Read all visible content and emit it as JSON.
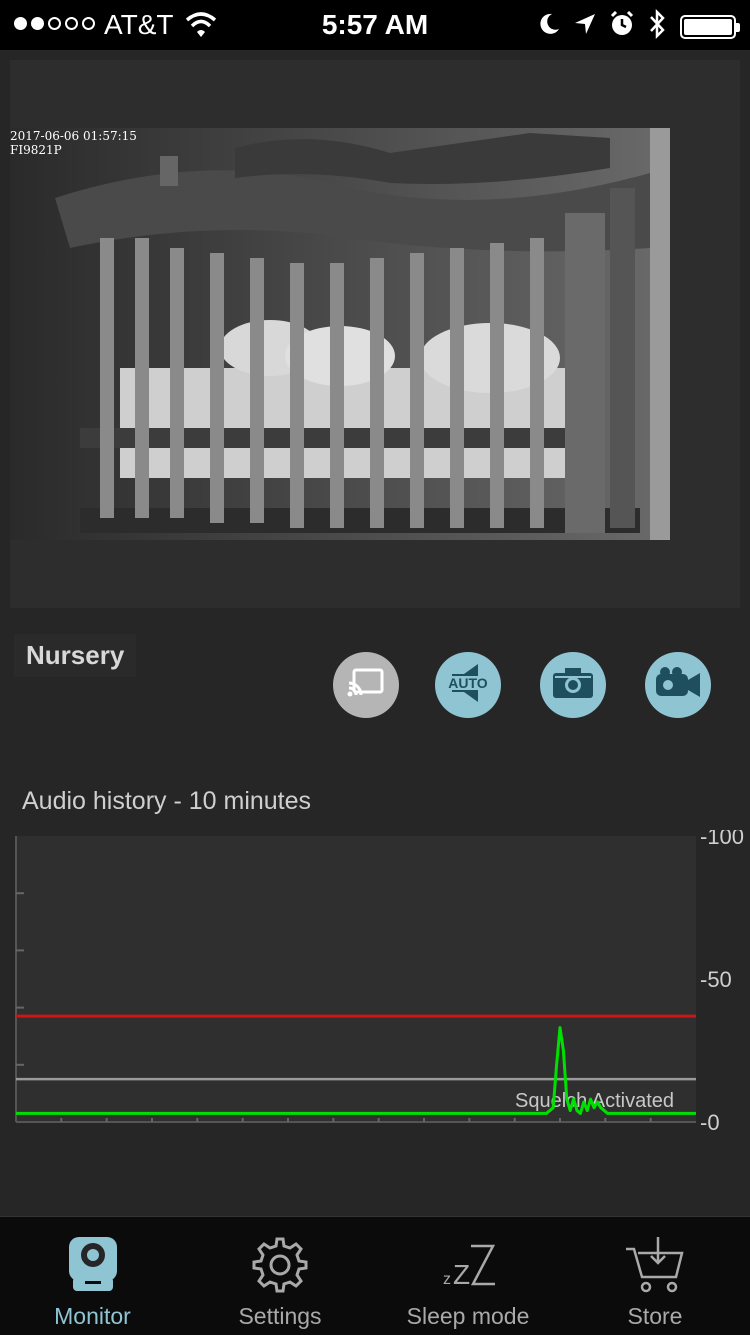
{
  "status_bar": {
    "carrier": "AT&T",
    "time": "5:57 AM",
    "signal_bars_filled": 2,
    "signal_bars_total": 5
  },
  "video": {
    "timestamp": "2017-06-06 01:57:15",
    "camera_model": "FI9821P"
  },
  "camera": {
    "name": "Nursery"
  },
  "controls": [
    {
      "name": "cast",
      "icon": "cast-icon"
    },
    {
      "name": "auto-audio",
      "icon": "auto-speaker-icon",
      "label": "AUTO"
    },
    {
      "name": "snapshot",
      "icon": "camera-icon"
    },
    {
      "name": "record",
      "icon": "video-camera-icon"
    }
  ],
  "audio": {
    "title": "Audio history -  10 minutes",
    "squelch_label": "Squelch Activated"
  },
  "chart_data": {
    "type": "line",
    "ylim": [
      0,
      100
    ],
    "y_ticks": [
      "-100",
      "-50",
      "-0"
    ],
    "threshold_red": 37,
    "squelch_level": 15,
    "series": [
      {
        "color": "#00e000",
        "x": [
          0,
          0.78,
          0.79,
          0.795,
          0.8,
          0.805,
          0.81,
          0.815,
          0.82,
          0.825,
          0.83,
          0.835,
          0.84,
          0.845,
          0.85,
          0.855,
          0.86,
          0.865,
          0.87,
          0.875,
          0.88,
          1.0
        ],
        "values": [
          3,
          3,
          5,
          20,
          33,
          25,
          8,
          4,
          8,
          4,
          3,
          7,
          4,
          8,
          5,
          7,
          5,
          4,
          3,
          3,
          3,
          3
        ]
      }
    ],
    "colors": {
      "red_line": "#d01515",
      "squelch_line": "#9a9a9a",
      "grid": "#555555"
    }
  },
  "tabs": [
    {
      "label": "Monitor",
      "icon": "monitor-camera-icon",
      "active": true
    },
    {
      "label": "Settings",
      "icon": "gear-icon",
      "active": false
    },
    {
      "label": "Sleep mode",
      "icon": "zzz-icon",
      "active": false
    },
    {
      "label": "Store",
      "icon": "cart-icon",
      "active": false
    }
  ]
}
